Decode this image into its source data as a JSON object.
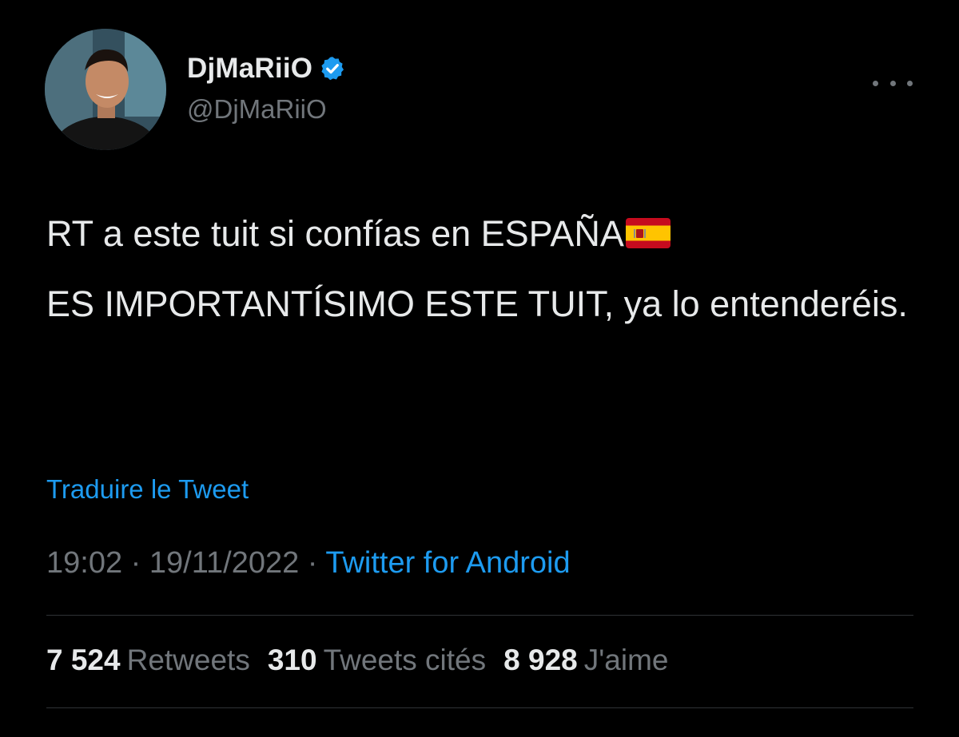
{
  "author": {
    "display_name": "DjMaRiiO",
    "handle": "@DjMaRiiO",
    "verified": true,
    "avatar": "profile-photo"
  },
  "tweet": {
    "line1": "RT a este tuit si confías en ESPAÑA",
    "line1_emoji": "spain-flag",
    "line2": "ES IMPORTANTÍSIMO ESTE TUIT, ya lo entenderéis."
  },
  "translate_label": "Traduire le Tweet",
  "meta": {
    "time": "19:02",
    "separator": " · ",
    "date": "19/11/2022",
    "source": "Twitter for Android"
  },
  "stats": [
    {
      "count": "7 524",
      "label": "Retweets"
    },
    {
      "count": "310",
      "label": "Tweets cités"
    },
    {
      "count": "8 928",
      "label": "J'aime"
    }
  ],
  "colors": {
    "background": "#000000",
    "text": "#e7e9ea",
    "muted": "#71767b",
    "accent": "#1d9bf0",
    "divider": "#2f3336"
  },
  "icons": {
    "verified": "verified-badge-icon",
    "more": "more-horizontal-icon"
  }
}
